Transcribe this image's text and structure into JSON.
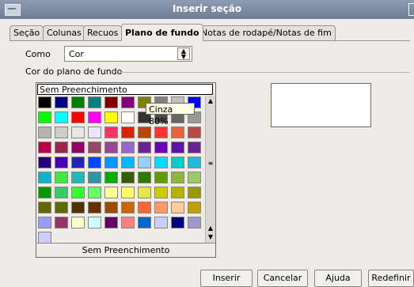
{
  "window": {
    "title": "Inserir seção"
  },
  "tabs": [
    {
      "label": "Seção"
    },
    {
      "label": "Colunas"
    },
    {
      "label": "Recuos"
    },
    {
      "label": "Plano de fundo"
    },
    {
      "label": "Notas de rodapé/Notas de fim"
    }
  ],
  "active_tab": "Plano de fundo",
  "como": {
    "label": "Como",
    "value": "Cor"
  },
  "section_label": "Cor do plano de fundo",
  "palette": {
    "no_fill_top": "Sem Preenchimento",
    "no_fill_bottom": "Sem Preenchimento",
    "tooltip": "Cinza 80%",
    "colors": [
      "#000000",
      "#000080",
      "#008000",
      "#008080",
      "#800000",
      "#800080",
      "#808000",
      "#808080",
      "#c0c0c0",
      "#0000ff",
      "#00ff00",
      "#00ffff",
      "#ff0000",
      "#ff00ff",
      "#ffff00",
      "#ffffff",
      "#333333",
      "#4c4c4c",
      "#666666",
      "#999999",
      "#b3b3b3",
      "#cccccc",
      "#e6e6e6",
      "#e6e6ff",
      "#ff3366",
      "#dc2300",
      "#b84700",
      "#ff3333",
      "#eb613d",
      "#b84747",
      "#b80047",
      "#99284c",
      "#94006b",
      "#94476b",
      "#944794",
      "#9966cc",
      "#6b2394",
      "#6b00b8",
      "#5e11a6",
      "#6b2394",
      "#28007a",
      "#4700b8",
      "#2323b8",
      "#0047ff",
      "#0099ff",
      "#00b8ff",
      "#99ccff",
      "#00dcff",
      "#00cccc",
      "#23b8dc",
      "#00b8cc",
      "#3deb3d",
      "#23b8b8",
      "#2d96a8",
      "#00ae00",
      "#355e00",
      "#2d7a00",
      "#5e9e00",
      "#8db83c",
      "#99cc66",
      "#009900",
      "#33cc66",
      "#33ff33",
      "#66ff66",
      "#ffff99",
      "#ffff66",
      "#e6e64c",
      "#cccc00",
      "#b3b300",
      "#999900",
      "#666600",
      "#5e6b00",
      "#4c3300",
      "#663300",
      "#994c00",
      "#cc6600",
      "#ff6633",
      "#ff9966",
      "#ffcc99",
      "#c0a000",
      "#9999ff",
      "#993366",
      "#ffffcc",
      "#ccffff",
      "#660066",
      "#ff8080",
      "#0066cc",
      "#ccccff",
      "#000080",
      "#9999cc",
      "#ccccff"
    ]
  },
  "buttons": {
    "inserir": "Inserir",
    "cancelar": "Cancelar",
    "ajuda": "Ajuda",
    "redefinir": "Redefinir"
  }
}
